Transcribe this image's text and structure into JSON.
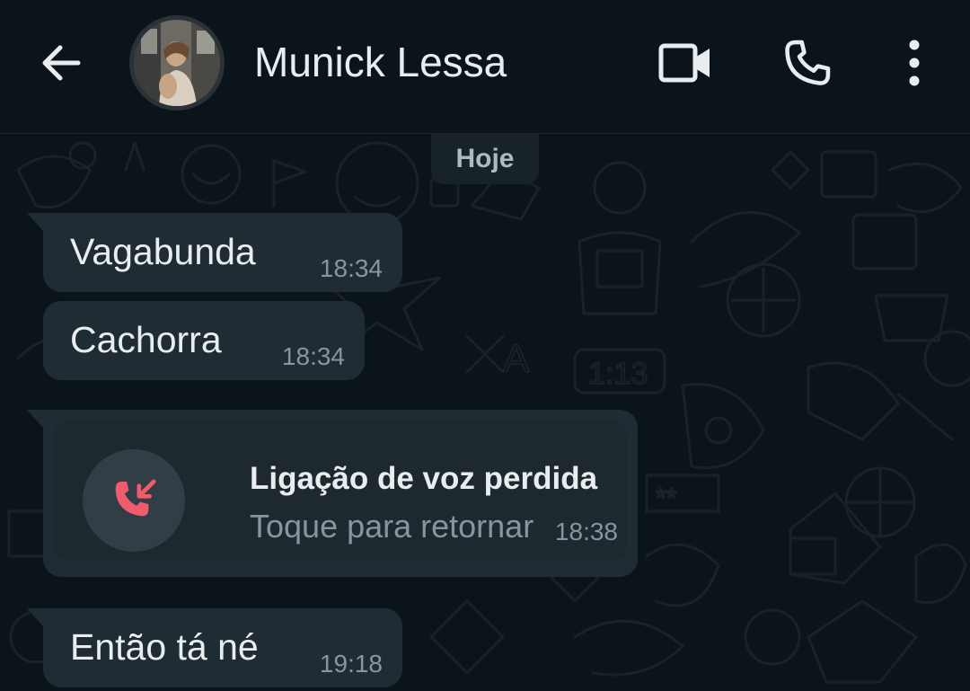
{
  "header": {
    "contact_name": "Munick Lessa",
    "icons": {
      "back": "arrow-left-icon",
      "video_call": "video-camera-icon",
      "voice_call": "phone-icon",
      "more": "more-vertical-icon"
    }
  },
  "chat": {
    "date_chip": "Hoje",
    "messages": [
      {
        "text": "Vagabunda",
        "time": "18:34"
      },
      {
        "text": "Cachorra",
        "time": "18:34"
      },
      {
        "text": "Então tá né",
        "time": "19:18"
      }
    ],
    "missed_call": {
      "title": "Ligação de voz perdida",
      "subtitle": "Toque para retornar",
      "time": "18:38",
      "icon": "missed-call-icon"
    }
  },
  "colors": {
    "background": "#0b141a",
    "bubble": "#202c33",
    "text": "#e9edef",
    "meta": "#8696a0",
    "missed_red": "#f15c6d"
  }
}
